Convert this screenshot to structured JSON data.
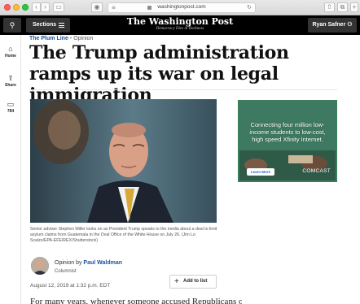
{
  "browser": {
    "url": "washingtonpost.com",
    "back_glyph": "‹",
    "forward_glyph": "›",
    "sidebar_glyph": "▭",
    "privacy_glyph": "◉",
    "reader_glyph": "≡",
    "reload_glyph": "↻",
    "share_glyph": "⇧",
    "tabs_glyph": "⧉",
    "new_tab_glyph": "+"
  },
  "header": {
    "search_glyph": "⚲",
    "sections_label": "Sections",
    "masthead": "The Washington Post",
    "tagline": "Democracy Dies in Darkness",
    "user_label": "Ryan Safner",
    "user_glyph": "⚇"
  },
  "rail": {
    "items": [
      {
        "icon": "home-icon",
        "glyph": "⌂",
        "label": "Home"
      },
      {
        "icon": "share-icon",
        "glyph": "⇪",
        "label": "Share"
      },
      {
        "icon": "comment-icon",
        "glyph": "▭",
        "label": "784"
      }
    ]
  },
  "article": {
    "blog": "The Plum Line",
    "separator": "•",
    "label": "Opinion",
    "headline": "The Trump administration ramps up its war on legal immigration",
    "caption": "Senior adviser Stephen Miller looks on as President Trump speaks to the media about a deal to limit asylum claims from Guatemala in the Oval Office of the White House on July 26. (Jim Lo Scalzo/EPA-EFE/REX/Shutterstock)",
    "byline_prefix": "Opinion by",
    "author": "Paul Waldman",
    "author_role": "Columnist",
    "date": "August 12, 2019 at 1:32 p.m. EDT",
    "add_to_list": "Add to list",
    "add_glyph": "+",
    "body_start": "For many years, whenever someone accused Republicans of"
  },
  "ad": {
    "text": "Connecting four million low-income students to low-cost, high speed Xfinity Internet.",
    "button": "Learn More",
    "brand": "COMCAST"
  },
  "colors": {
    "link_blue": "#1955a5",
    "header_black": "#000000",
    "ad_green": "#44806a"
  }
}
